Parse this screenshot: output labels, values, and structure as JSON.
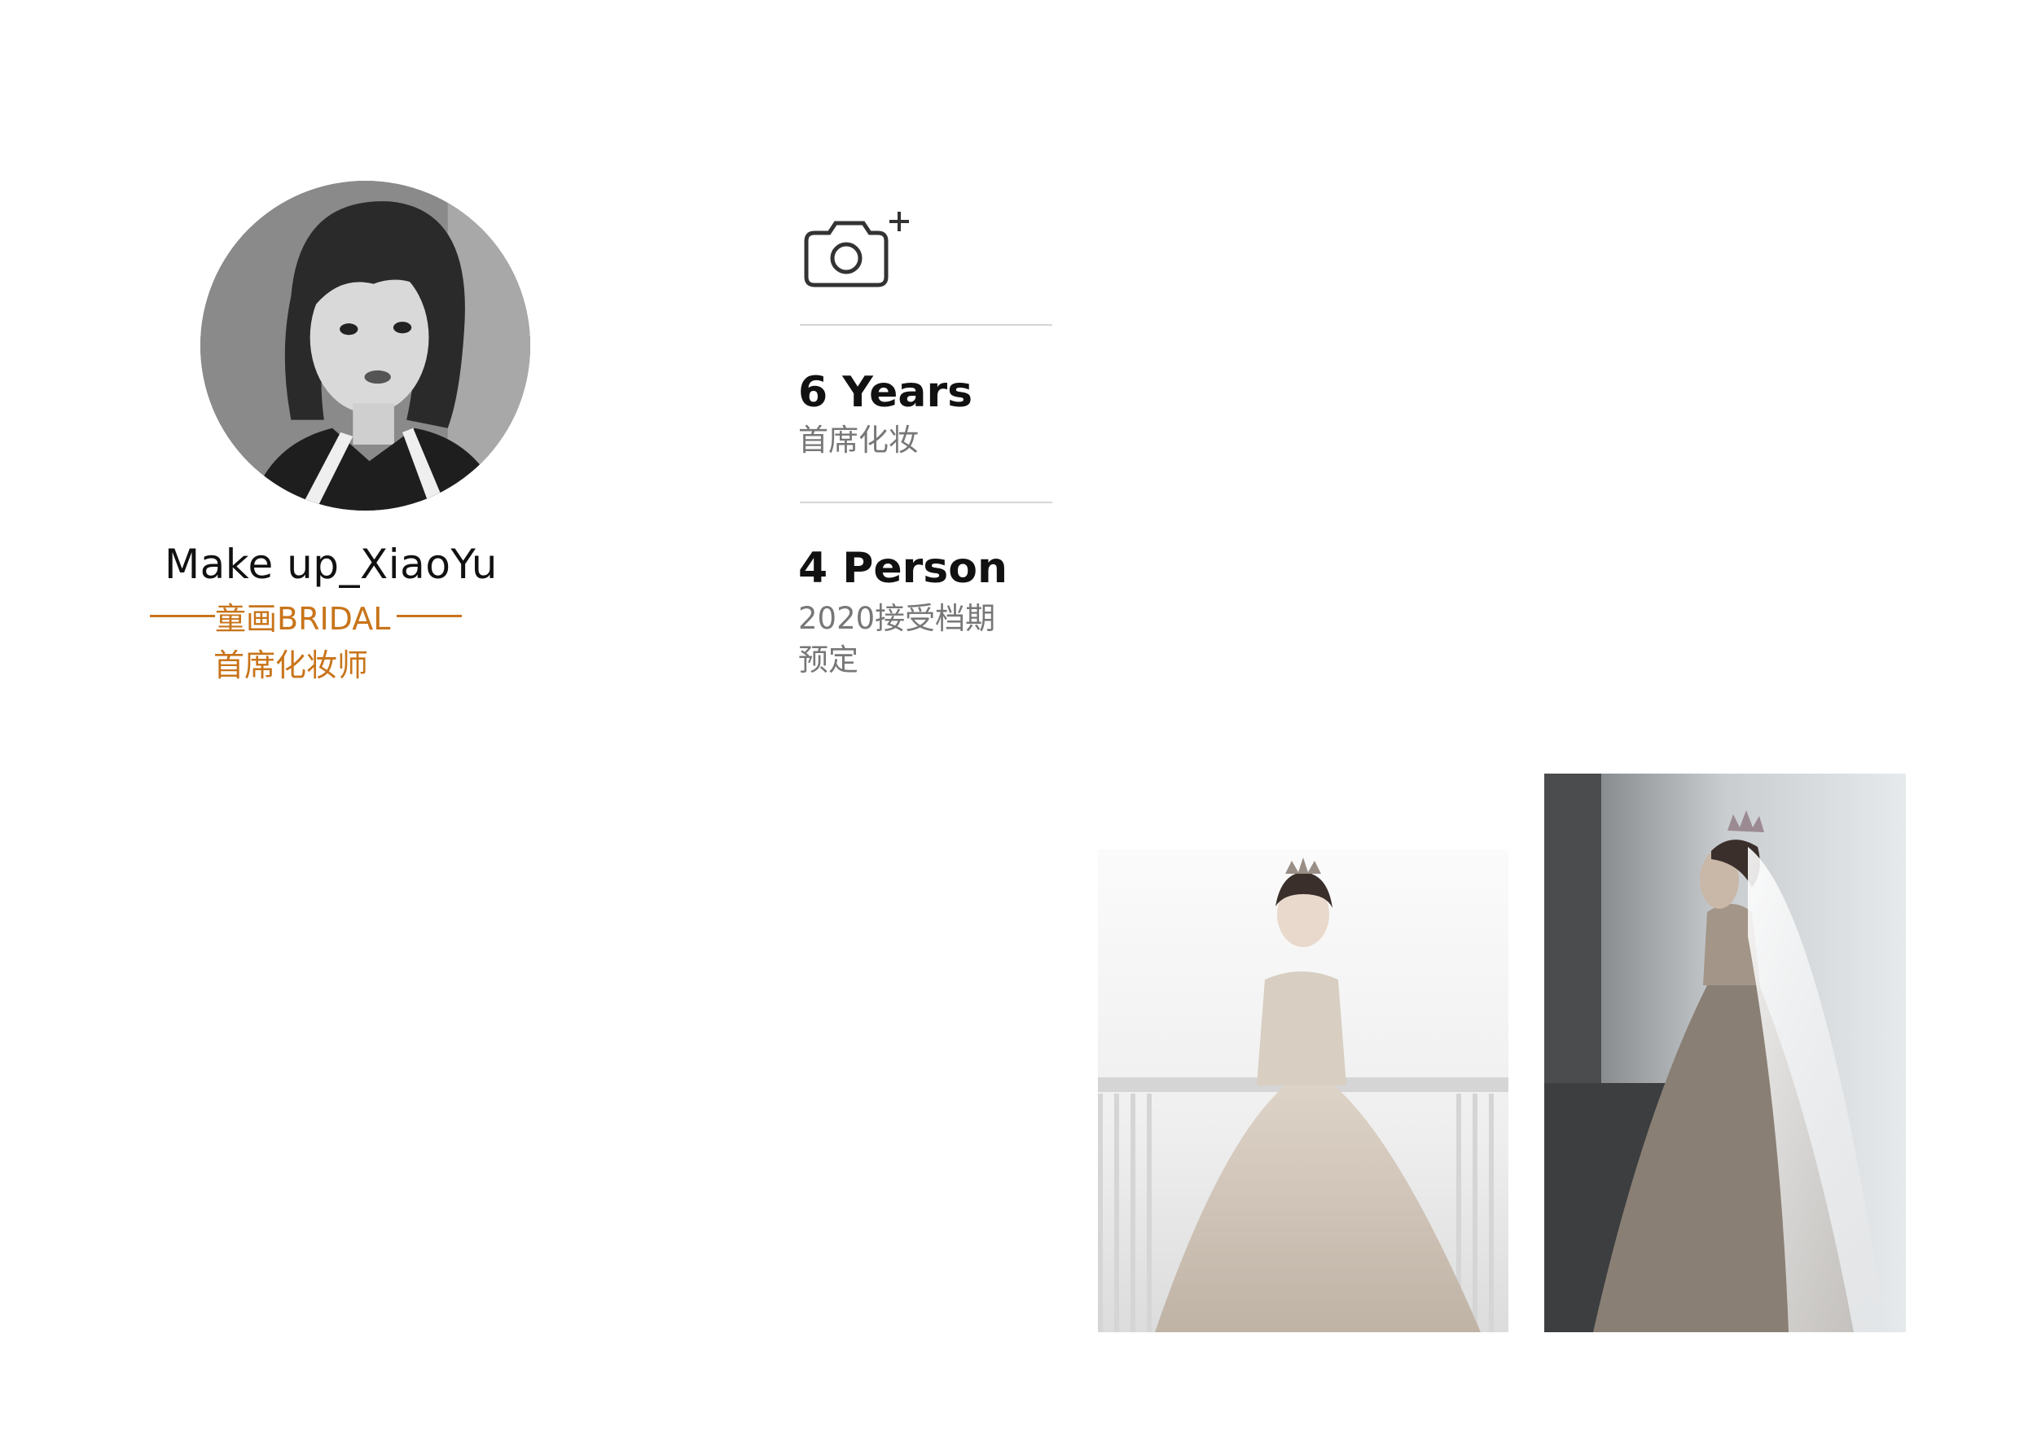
{
  "profile": {
    "name": "Make up_XiaoYu",
    "studio": "童画BRIDAL",
    "title": "首席化妆师"
  },
  "stats": [
    {
      "value": "6 Years",
      "desc_line1": "首席化妆",
      "desc_line2": ""
    },
    {
      "value": "4 Person",
      "desc_line1": "2020接受档期",
      "desc_line2": "预定"
    }
  ],
  "icons": {
    "camera": "camera-add-icon"
  },
  "colors": {
    "accent": "#c8741a",
    "text": "#111111",
    "muted": "#777777",
    "divider": "#d6d6d6"
  }
}
